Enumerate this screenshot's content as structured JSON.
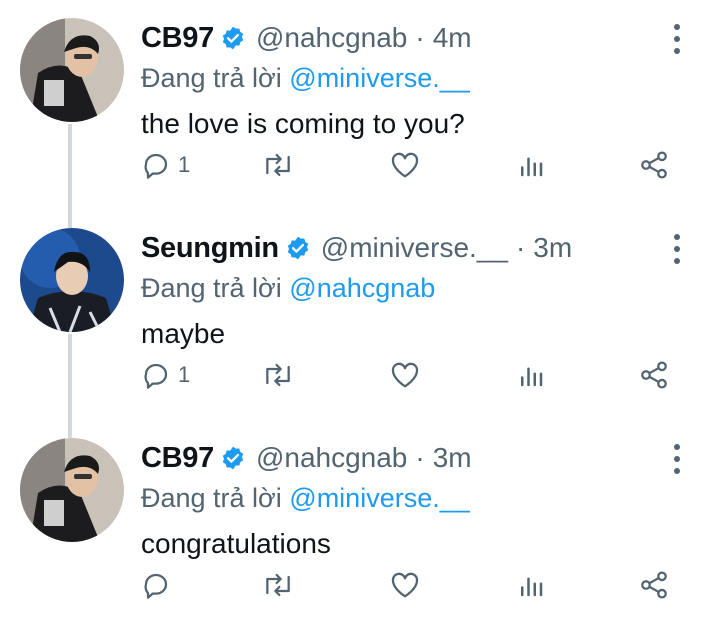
{
  "colors": {
    "accent": "#1d9bf0",
    "muted": "#536471",
    "text": "#0f1419",
    "thread_line": "#cfd9de"
  },
  "tweets": [
    {
      "name": "CB97",
      "verified": true,
      "handle": "@nahcgnab",
      "separator": "·",
      "time": "4m",
      "reply_prefix": "Đang trả lời",
      "reply_to": "@miniverse.__",
      "text": "the love is coming to you?",
      "reply_count": "1",
      "avatar": "person-photo-cb97"
    },
    {
      "name": "Seungmin",
      "verified": true,
      "handle": "@miniverse.__",
      "separator": "·",
      "time": "3m",
      "reply_prefix": "Đang trả lời",
      "reply_to": "@nahcgnab",
      "text": "maybe",
      "reply_count": "1",
      "avatar": "person-photo-seungmin"
    },
    {
      "name": "CB97",
      "verified": true,
      "handle": "@nahcgnab",
      "separator": "·",
      "time": "3m",
      "reply_prefix": "Đang trả lời",
      "reply_to": "@miniverse.__",
      "text": "congratulations",
      "reply_count": "",
      "avatar": "person-photo-cb97"
    }
  ],
  "icons": [
    "reply-icon",
    "retweet-icon",
    "like-icon",
    "analytics-icon",
    "share-icon",
    "more-options-icon",
    "verified-badge-icon"
  ]
}
